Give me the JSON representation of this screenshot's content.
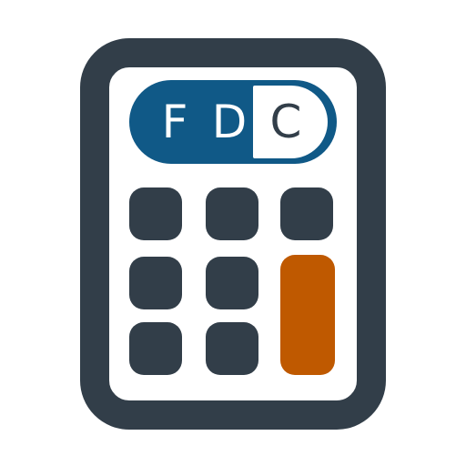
{
  "display": {
    "letters": [
      "F",
      "D",
      "C"
    ]
  },
  "colors": {
    "body": "#323e49",
    "display": "#105987",
    "accent_key": "#bf5900",
    "face": "#ffffff"
  },
  "icon": "calculator-icon"
}
